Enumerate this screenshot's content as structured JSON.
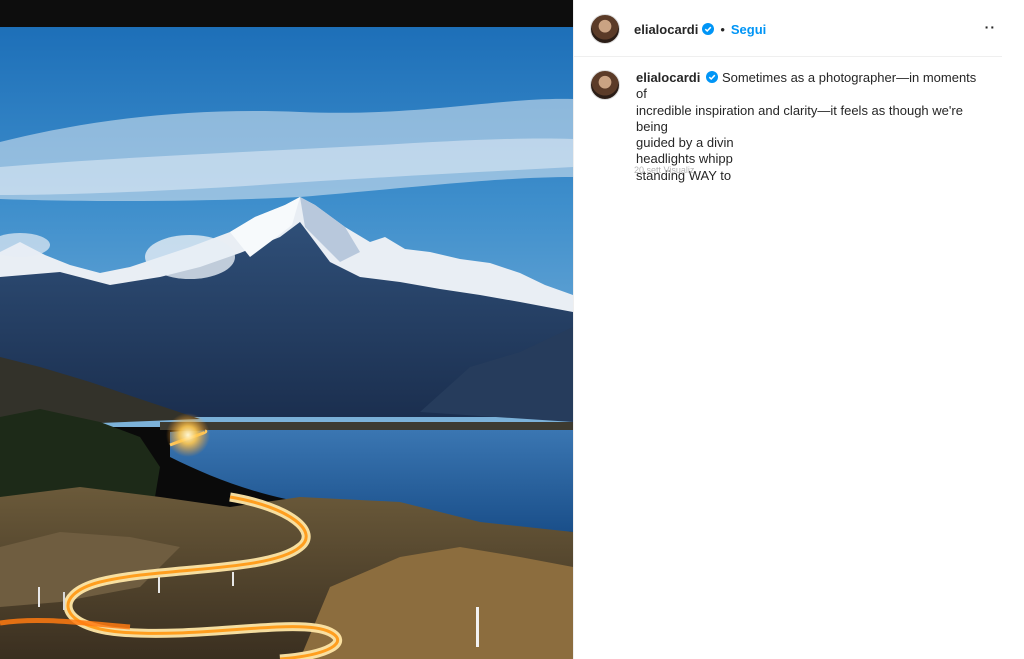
{
  "post": {
    "username": "elialocardi",
    "follow_label": "Segui",
    "separator": "•",
    "more_label": "··",
    "caption_line1": "Sometimes as a photographer—in moments of",
    "caption_line2": "incredible inspiration and clarity—it feels as though we're being",
    "caption_line3": "guided by a divin",
    "caption_line4": "headlights whipp",
    "caption_line5": "standing WAY to",
    "timestamp_partial": "20 sett    Visualiz"
  }
}
